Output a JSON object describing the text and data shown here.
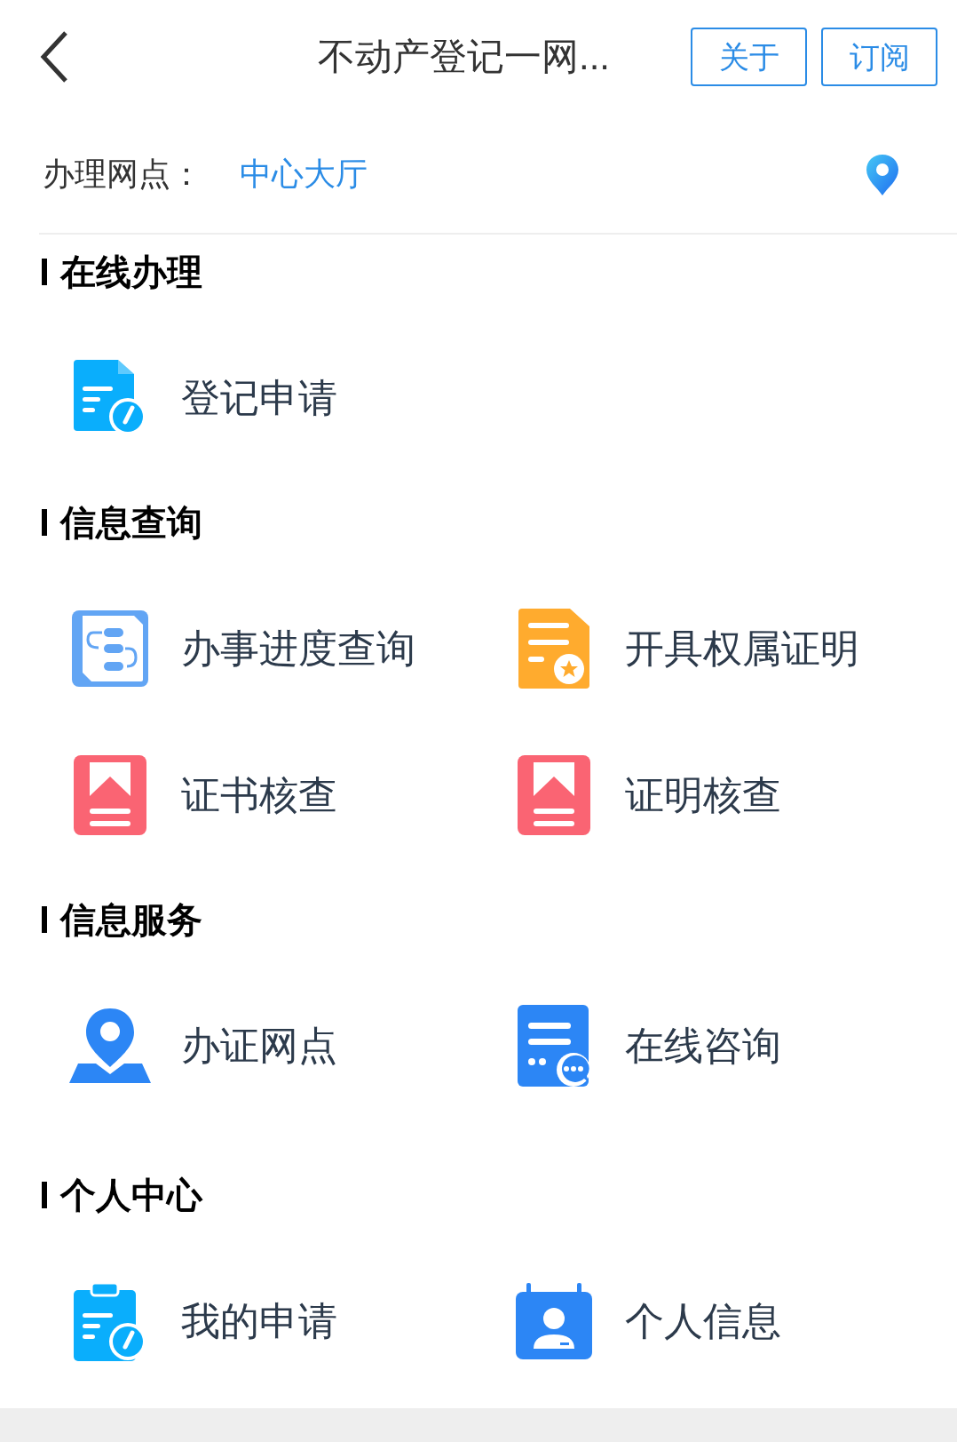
{
  "header": {
    "title": "不动产登记一网...",
    "buttons": [
      "关于",
      "订阅"
    ]
  },
  "site": {
    "label": "办理网点：",
    "value": "中心大厅"
  },
  "sections": [
    {
      "title": "在线办理",
      "items": [
        {
          "label": "登记申请"
        }
      ]
    },
    {
      "title": "信息查询",
      "items": [
        {
          "label": "办事进度查询"
        },
        {
          "label": "开具权属证明"
        },
        {
          "label": "证书核查"
        },
        {
          "label": "证明核查"
        }
      ]
    },
    {
      "title": "信息服务",
      "items": [
        {
          "label": "办证网点"
        },
        {
          "label": "在线咨询"
        }
      ]
    },
    {
      "title": "个人中心",
      "items": [
        {
          "label": "我的申请"
        },
        {
          "label": "个人信息"
        }
      ]
    }
  ]
}
